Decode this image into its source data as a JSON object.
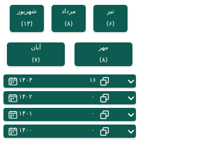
{
  "months_top": [
    {
      "name": "شهریور",
      "count": "(۱۳)"
    },
    {
      "name": "مرداد",
      "count": "(۸)"
    },
    {
      "name": "تیر",
      "count": "(۶)"
    }
  ],
  "months_mid": [
    {
      "name": "آبان",
      "count": "(۷)"
    },
    {
      "name": "مهر",
      "count": "(۸)"
    }
  ],
  "years": [
    {
      "year": "۱۴۰۳",
      "count": "۱۶"
    },
    {
      "year": "۱۴۰۲",
      "count": "۰"
    },
    {
      "year": "۱۴۰۱",
      "count": "۰"
    },
    {
      "year": "۱۴۰۰",
      "count": "۰"
    }
  ],
  "colors": {
    "accent": "#0d5c52",
    "text": "#ffffff",
    "background": "#ffffff"
  },
  "icons": {
    "row_expand": "chevron-down-icon",
    "row_copy": "copy-icon",
    "row_calendar": "calendar-icon"
  }
}
